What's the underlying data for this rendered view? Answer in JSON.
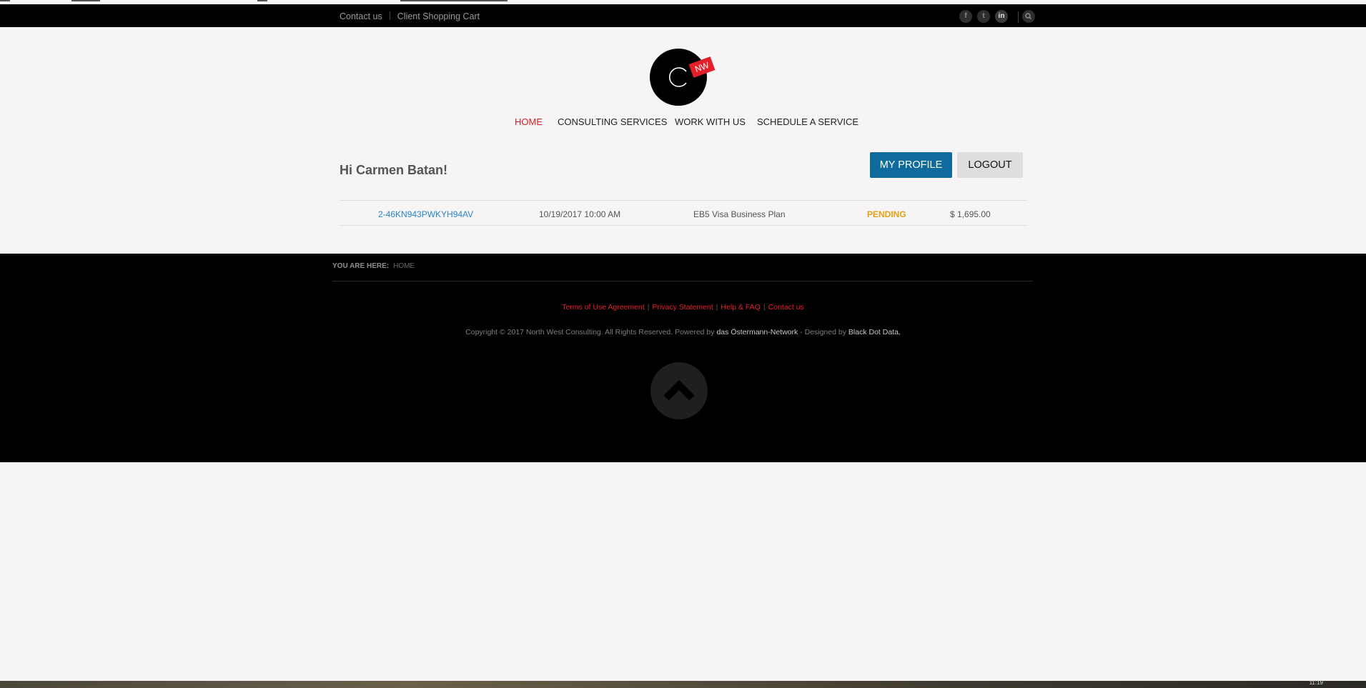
{
  "topbar": {
    "links": [
      "Contact us",
      "Client Shopping Cart"
    ],
    "social_icons": [
      "facebook-icon",
      "twitter-icon",
      "linkedin-icon"
    ],
    "social_glyphs": [
      "f",
      "t",
      "in"
    ],
    "search_icon": "search-icon"
  },
  "logo": {
    "letter": "C",
    "tag": "NW"
  },
  "nav": [
    "HOME",
    "CONSULTING SERVICES",
    "WORK WITH US",
    "SCHEDULE A SERVICE"
  ],
  "account": {
    "greeting": "Hi Carmen Batan!",
    "profile_button": "MY PROFILE",
    "logout_button": "LOGOUT"
  },
  "orders": [
    {
      "id": "2-46KN943PWKYH94AV",
      "date": "10/19/2017 10:00 AM",
      "service": "EB5 Visa Business Plan",
      "status": "PENDING",
      "amount": "$ 1,695.00"
    }
  ],
  "footer": {
    "breadcrumb_label": "YOU ARE HERE:",
    "breadcrumb_value": "HOME",
    "links": [
      "Terms of Use Agreement",
      "Privacy Statement",
      "Help & FAQ",
      "Contact us"
    ],
    "copyright_prefix": "Copyright © 2017 North West Consulting. All Rights Reserved. Powered by",
    "powered_by": "das Östermann-Network",
    "designed_prefix": "- Designed by",
    "designer": "Black Dot Data.",
    "back_to_top_icon": "chevron-up-icon"
  },
  "taskbar": {
    "clock": "11:19"
  },
  "colors": {
    "accent_red": "#e3202a",
    "profile_blue": "#0f6b9e",
    "pending_amber": "#e3a117",
    "link_blue": "#2a86c7",
    "page_bg": "#f6f4f5"
  }
}
